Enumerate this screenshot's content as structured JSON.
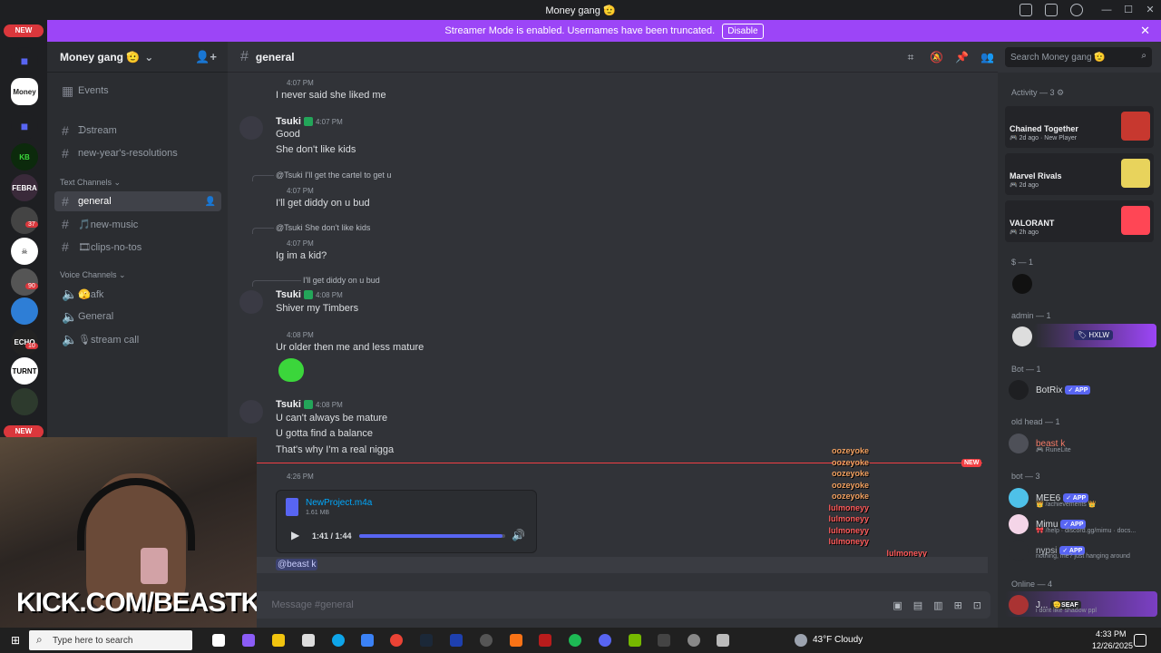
{
  "window": {
    "title": "Money gang 🫡",
    "min": "—",
    "max": "☐",
    "close": "✕"
  },
  "banner": {
    "text": "Streamer Mode is enabled. Usernames have been truncated.",
    "button": "Disable",
    "close": "✕"
  },
  "rail": {
    "new_top": "NEW",
    "new_bottom": "NEW",
    "badges": [
      "37",
      "90",
      "10"
    ],
    "labels": [
      "Money",
      "KB",
      "FEBRA",
      "TURNT",
      "ECHO"
    ]
  },
  "server": {
    "name": "Money gang 🫡",
    "chevron": "⌄"
  },
  "channels": {
    "events": "Events",
    "top": [
      {
        "name": "ᗪstream"
      },
      {
        "name": "new-year's-resolutions"
      }
    ],
    "text_category": "Text Channels ⌄",
    "text": [
      {
        "name": "general"
      },
      {
        "name": "🎵new-music"
      },
      {
        "name": "🎞clips-no-tos"
      }
    ],
    "voice_category": "Voice Channels ⌄",
    "voice": [
      {
        "name": "🫣afk"
      },
      {
        "name": "General"
      },
      {
        "name": "🎙stream call"
      }
    ]
  },
  "header": {
    "channel": "general",
    "search_placeholder": "Search Money gang 🫡"
  },
  "messages": [
    {
      "time": "4:07 PM",
      "text": "I never said she liked me"
    },
    {
      "author": "Tsuki",
      "time": "4:07 PM",
      "lines": [
        "Good",
        "She don't like kids"
      ]
    },
    {
      "reply": "@Tsuki I'll get the cartel to get u",
      "time": "4:07 PM",
      "text": "I'll get diddy on u bud"
    },
    {
      "reply": "@Tsuki She don't like kids",
      "time": "4:07 PM",
      "text": "Ig im a kid?"
    },
    {
      "reply": "I'll get diddy on u bud",
      "author": "Tsuki",
      "time": "4:08 PM",
      "text": "Shiver my Timbers"
    },
    {
      "time": "4:08 PM",
      "text": "Ur older then me and less mature"
    },
    {
      "author": "Tsuki",
      "time": "4:08 PM",
      "lines": [
        "U can't always be mature",
        "U gotta find a balance",
        "That's why I'm a real nigga"
      ]
    },
    {
      "time": "4:26 PM",
      "attachment": {
        "name": "NewProject.m4a",
        "size": "1.61 MB",
        "time": "1:41 / 1:44",
        "progress": 0.98
      }
    }
  ],
  "new_marker": "NEW",
  "overlay_names": [
    "oozeyoke",
    "oozeyoke",
    "oozeyoke",
    "oozeyoke",
    "oozeyoke",
    "lulmoneyy",
    "lulmoneyy",
    "lulmoneyy",
    "lulmoneyy",
    "lulmoneyy"
  ],
  "mention": "@beast k",
  "composer": {
    "placeholder": "Message #general"
  },
  "members": {
    "activity_header": "Activity — 3 ⚙",
    "activities": [
      {
        "game": "Chained Together",
        "sub": "🎮 2d ago  ·  New Player",
        "color": "#c7382f"
      },
      {
        "game": "Marvel Rivals",
        "sub": "🎮 2d ago",
        "color": "#e8d35c"
      },
      {
        "game": "VALORANT",
        "sub": "🎮 2h ago",
        "color": "#ff4655"
      }
    ],
    "groups": [
      {
        "title": "$ — 1"
      },
      {
        "title": "admin — 1",
        "tag": "🏷 HXLW"
      },
      {
        "title": "Bot — 1",
        "name": "BotRix",
        "app": "✓ APP"
      },
      {
        "title": "old head — 1",
        "name": "beast k",
        "sub": "🎮 RuneLite"
      },
      {
        "title": "bot — 3"
      },
      {
        "title": "Online — 4",
        "name": "J...",
        "tag": "🫡SEAF",
        "sub": "i dont like shadow ppl"
      }
    ],
    "bots": [
      {
        "name": "MEE6",
        "app": "✓ APP",
        "sub": "👑 /achievements 👑"
      },
      {
        "name": "Mimu",
        "app": "✓ APP",
        "sub": "🎀 /help · discord.gg/mimu · docs..."
      },
      {
        "name": "nypsi",
        "app": "✓ APP",
        "sub": "nothing, me? just hanging around"
      }
    ]
  },
  "webcam": {
    "overlay": "KICK.COM/BEASTK"
  },
  "taskbar": {
    "search_placeholder": "Type here to search",
    "weather": "43°F  Cloudy",
    "time": "4:33 PM",
    "date": "12/26/2025"
  }
}
